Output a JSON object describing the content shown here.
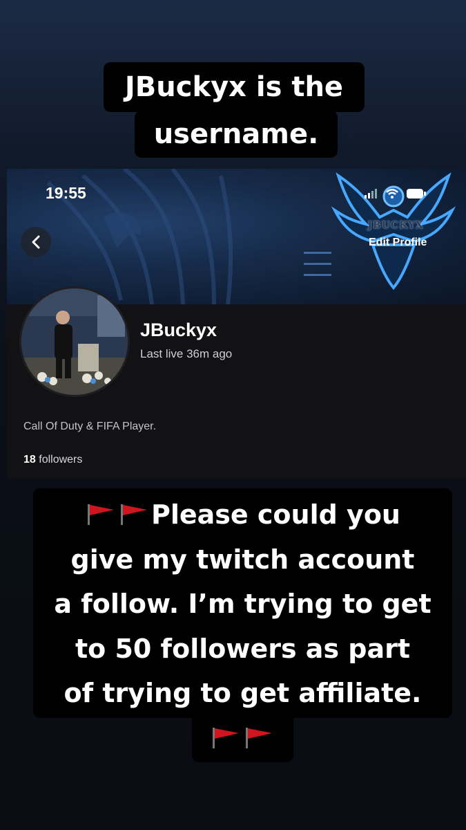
{
  "caption": {
    "line1": "JBuckyx is the",
    "line2": "username."
  },
  "profile": {
    "status_time": "19:55",
    "logo_text": "JBUCKYX",
    "edit_profile_label": "Edit Profile",
    "username": "JBuckyx",
    "last_live": "Last live 36m ago",
    "bio": "Call Of Duty & FIFA Player.",
    "followers_count": "18",
    "followers_label": "followers"
  },
  "message": {
    "line1": "Please could you",
    "line2": "give my twitch account",
    "line3": "a follow. I’m trying to get",
    "line4": "to 50 followers as part",
    "line5": "of trying to get affiliate.",
    "flag_icon": "red-flag-icon"
  },
  "colors": {
    "caption_bg": "#000000",
    "banner_blue": "#162a48",
    "accent_blue": "#4aa3ff",
    "flag_red": "#d0151f"
  }
}
